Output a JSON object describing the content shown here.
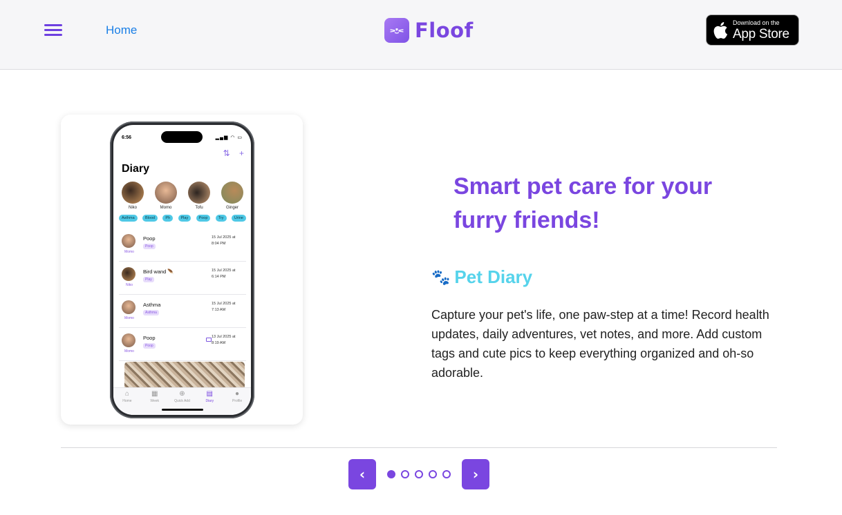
{
  "header": {
    "nav_home": "Home",
    "logo_text": "Floof",
    "appstore_small": "Download on the",
    "appstore_big": "App Store"
  },
  "phone": {
    "status_time": "6:56",
    "screen_title": "Diary",
    "pets": [
      "Niko",
      "Momo",
      "Tofu",
      "Ginger"
    ],
    "tags": [
      "Asthma",
      "Blood",
      "Ph",
      "Play",
      "Poop",
      "Try",
      "Urine"
    ],
    "entries": [
      {
        "owner": "Momo",
        "title": "Poop",
        "chip": "Poop",
        "date": "15 Jul 2025 at 8:04 PM"
      },
      {
        "owner": "Niko",
        "title": "Bird wand 🪶",
        "chip": "Play",
        "date": "15 Jul 2025 at 6:14 PM"
      },
      {
        "owner": "Momo",
        "title": "Asthma",
        "chip": "Asthma",
        "date": "15 Jul 2025 at 7:13 AM"
      },
      {
        "owner": "Momo",
        "title": "Poop",
        "chip": "Poop",
        "date": "13 Jul 2025 at 8:19 AM"
      }
    ],
    "tabs": [
      "Home",
      "Week",
      "Quick Add",
      "Diary",
      "Profile"
    ]
  },
  "content": {
    "headline": "Smart pet care for your furry friends!",
    "feature_icon": "🐾",
    "feature_title": "Pet Diary",
    "feature_description": "Capture your pet's life, one paw-step at a time! Record health updates, daily adventures, vet notes, and more. Add custom tags and cute pics to keep everything organized and oh-so adorable."
  },
  "carousel": {
    "prev_label": "‹",
    "next_label": "›",
    "slide_count": 5,
    "active_index": 0
  },
  "colors": {
    "brand_purple": "#7a46e0",
    "accent_cyan": "#56d3eb",
    "link_blue": "#1a7fe6"
  }
}
